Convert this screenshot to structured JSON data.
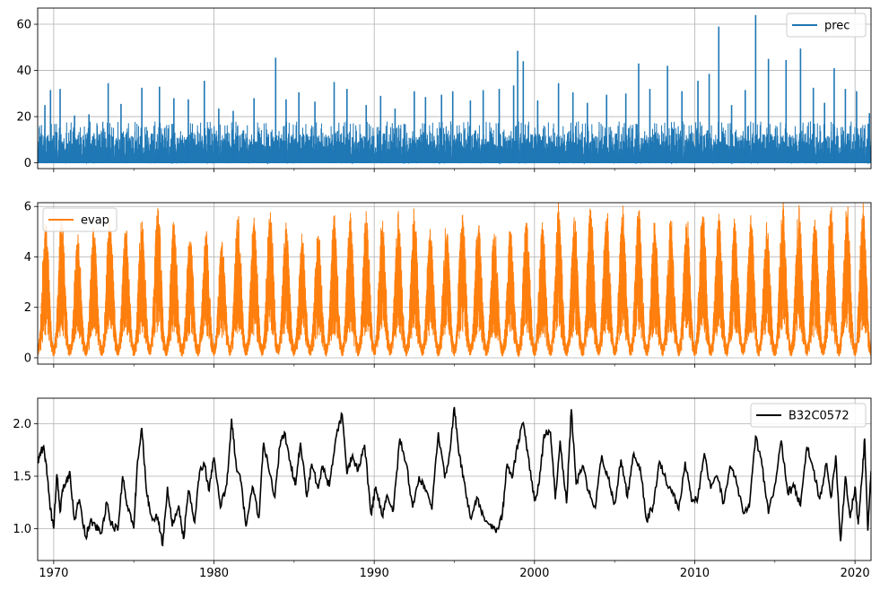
{
  "chart_data": [
    {
      "type": "line",
      "title": "",
      "xlabel": "",
      "ylabel": "",
      "xlim": [
        1969.0,
        2021.0
      ],
      "ylim": [
        -2.5,
        67.0
      ],
      "yticks": [
        0,
        20,
        40,
        60
      ],
      "ytick_labels": [
        "0",
        "20",
        "40",
        "60"
      ],
      "grid": true,
      "legend": "top-right",
      "series": [
        {
          "name": "prec",
          "color": "#1f77b4",
          "pattern": "daily precipitation spikes",
          "peaks": [
            [
              1969.45,
              25.0
            ],
            [
              1969.8,
              31.5
            ],
            [
              1970.4,
              32.0
            ],
            [
              1971.3,
              20.5
            ],
            [
              1972.2,
              21.0
            ],
            [
              1973.4,
              34.5
            ],
            [
              1974.2,
              25.5
            ],
            [
              1975.5,
              32.5
            ],
            [
              1976.6,
              33.0
            ],
            [
              1977.5,
              28.0
            ],
            [
              1978.4,
              27.5
            ],
            [
              1979.4,
              35.5
            ],
            [
              1980.3,
              23.5
            ],
            [
              1981.2,
              22.5
            ],
            [
              1982.5,
              28.0
            ],
            [
              1983.85,
              45.5
            ],
            [
              1984.5,
              27.5
            ],
            [
              1985.3,
              30.5
            ],
            [
              1986.3,
              26.5
            ],
            [
              1987.5,
              35.0
            ],
            [
              1988.3,
              32.0
            ],
            [
              1989.5,
              25.0
            ],
            [
              1990.4,
              29.0
            ],
            [
              1991.3,
              23.5
            ],
            [
              1992.5,
              31.0
            ],
            [
              1993.2,
              28.5
            ],
            [
              1994.2,
              29.5
            ],
            [
              1994.9,
              31.0
            ],
            [
              1996.0,
              27.0
            ],
            [
              1996.8,
              31.5
            ],
            [
              1997.8,
              32.0
            ],
            [
              1998.7,
              33.5
            ],
            [
              1998.95,
              48.5
            ],
            [
              1999.3,
              44.0
            ],
            [
              2000.2,
              27.0
            ],
            [
              2001.5,
              34.5
            ],
            [
              2002.4,
              30.5
            ],
            [
              2003.3,
              26.0
            ],
            [
              2004.5,
              29.5
            ],
            [
              2005.7,
              30.0
            ],
            [
              2006.5,
              43.0
            ],
            [
              2007.2,
              32.0
            ],
            [
              2008.3,
              42.0
            ],
            [
              2009.2,
              31.0
            ],
            [
              2010.2,
              35.5
            ],
            [
              2010.9,
              38.5
            ],
            [
              2011.5,
              59.0
            ],
            [
              2012.3,
              25.0
            ],
            [
              2013.15,
              31.5
            ],
            [
              2013.8,
              64.0
            ],
            [
              2014.6,
              45.0
            ],
            [
              2015.7,
              44.5
            ],
            [
              2016.6,
              49.5
            ],
            [
              2017.4,
              32.5
            ],
            [
              2018.1,
              26.0
            ],
            [
              2018.7,
              41.0
            ],
            [
              2019.4,
              32.0
            ],
            [
              2020.1,
              31.0
            ],
            [
              2020.9,
              21.5
            ]
          ]
        }
      ]
    },
    {
      "type": "line",
      "title": "",
      "xlabel": "",
      "ylabel": "",
      "xlim": [
        1969.0,
        2021.0
      ],
      "ylim": [
        -0.25,
        6.15
      ],
      "yticks": [
        0,
        2,
        4,
        6
      ],
      "ytick_labels": [
        "0",
        "2",
        "4",
        "6"
      ],
      "grid": true,
      "legend": "top-left",
      "series": [
        {
          "name": "evap",
          "color": "#ff7f0e",
          "pattern": "seasonal daily evaporation",
          "annual_peaks": [
            [
              1969.5,
              5.1
            ],
            [
              1970.5,
              5.2
            ],
            [
              1971.5,
              4.6
            ],
            [
              1972.5,
              4.8
            ],
            [
              1973.5,
              5.4
            ],
            [
              1974.5,
              4.8
            ],
            [
              1975.5,
              5.2
            ],
            [
              1976.5,
              5.7
            ],
            [
              1977.5,
              5.2
            ],
            [
              1978.5,
              4.6
            ],
            [
              1979.5,
              4.7
            ],
            [
              1980.5,
              4.4
            ],
            [
              1981.5,
              5.3
            ],
            [
              1982.5,
              5.2
            ],
            [
              1983.5,
              5.6
            ],
            [
              1984.5,
              5.2
            ],
            [
              1985.5,
              4.4
            ],
            [
              1986.5,
              4.8
            ],
            [
              1987.5,
              5.2
            ],
            [
              1988.5,
              5.4
            ],
            [
              1989.5,
              5.3
            ],
            [
              1990.5,
              5.2
            ],
            [
              1991.5,
              5.3
            ],
            [
              1992.5,
              5.5
            ],
            [
              1993.5,
              5.0
            ],
            [
              1994.5,
              5.1
            ],
            [
              1995.5,
              5.5
            ],
            [
              1996.5,
              5.1
            ],
            [
              1997.5,
              4.8
            ],
            [
              1998.5,
              4.8
            ],
            [
              1999.5,
              5.3
            ],
            [
              2000.5,
              5.1
            ],
            [
              2001.5,
              5.8
            ],
            [
              2002.5,
              5.3
            ],
            [
              2003.5,
              5.8
            ],
            [
              2004.5,
              5.6
            ],
            [
              2005.5,
              5.6
            ],
            [
              2006.5,
              5.6
            ],
            [
              2007.5,
              5.1
            ],
            [
              2008.5,
              5.3
            ],
            [
              2009.5,
              5.2
            ],
            [
              2010.5,
              5.6
            ],
            [
              2011.5,
              5.4
            ],
            [
              2012.5,
              5.1
            ],
            [
              2013.5,
              5.3
            ],
            [
              2014.5,
              5.0
            ],
            [
              2015.5,
              5.9
            ],
            [
              2016.5,
              5.6
            ],
            [
              2017.5,
              5.3
            ],
            [
              2018.5,
              5.7
            ],
            [
              2019.5,
              5.7
            ],
            [
              2020.5,
              5.6
            ]
          ],
          "base_value": 0.05
        }
      ]
    },
    {
      "type": "line",
      "title": "",
      "xlabel": "",
      "ylabel": "",
      "xlim": [
        1969.0,
        2021.0
      ],
      "ylim": [
        0.695,
        2.245
      ],
      "yticks": [
        1.0,
        1.5,
        2.0
      ],
      "ytick_labels": [
        "1.0",
        "1.5",
        "2.0"
      ],
      "xticks": [
        1970,
        1980,
        1990,
        2000,
        2010,
        2020
      ],
      "xtick_labels": [
        "1970",
        "1980",
        "1990",
        "2000",
        "2010",
        "2020"
      ],
      "grid": true,
      "legend": "top-right",
      "series": [
        {
          "name": "B32C0572",
          "color": "#000000",
          "x": [
            1969.0,
            1969.2,
            1969.4,
            1969.6,
            1969.8,
            1970.0,
            1970.2,
            1970.4,
            1970.6,
            1970.8,
            1971.0,
            1971.3,
            1971.6,
            1972.0,
            1972.3,
            1972.6,
            1973.0,
            1973.3,
            1973.6,
            1974.0,
            1974.3,
            1974.6,
            1975.0,
            1975.2,
            1975.5,
            1975.8,
            1976.1,
            1976.5,
            1976.8,
            1977.1,
            1977.4,
            1977.8,
            1978.1,
            1978.4,
            1978.8,
            1979.1,
            1979.4,
            1979.7,
            1980.0,
            1980.4,
            1980.8,
            1981.1,
            1981.4,
            1981.7,
            1982.0,
            1982.4,
            1982.8,
            1983.1,
            1983.4,
            1983.8,
            1984.1,
            1984.4,
            1984.8,
            1985.1,
            1985.4,
            1985.8,
            1986.1,
            1986.5,
            1986.8,
            1987.2,
            1987.6,
            1988.0,
            1988.3,
            1988.6,
            1989.0,
            1989.4,
            1989.8,
            1990.1,
            1990.5,
            1990.8,
            1991.2,
            1991.6,
            1992.0,
            1992.4,
            1992.8,
            1993.2,
            1993.6,
            1994.0,
            1994.4,
            1994.7,
            1995.0,
            1995.3,
            1995.6,
            1996.0,
            1996.4,
            1996.8,
            1997.2,
            1997.6,
            1998.0,
            1998.3,
            1998.6,
            1999.0,
            1999.3,
            1999.6,
            2000.0,
            2000.3,
            2000.6,
            2001.0,
            2001.3,
            2001.6,
            2002.0,
            2002.3,
            2002.6,
            2003.0,
            2003.4,
            2003.8,
            2004.2,
            2004.6,
            2005.0,
            2005.4,
            2005.8,
            2006.2,
            2006.6,
            2007.0,
            2007.4,
            2007.8,
            2008.2,
            2008.6,
            2009.0,
            2009.4,
            2009.8,
            2010.2,
            2010.6,
            2011.0,
            2011.4,
            2011.8,
            2012.2,
            2012.6,
            2013.0,
            2013.4,
            2013.8,
            2014.2,
            2014.6,
            2015.0,
            2015.4,
            2015.8,
            2016.2,
            2016.6,
            2017.0,
            2017.4,
            2017.8,
            2018.2,
            2018.5,
            2018.8,
            2019.1,
            2019.4,
            2019.7,
            2020.0,
            2020.2,
            2020.4,
            2020.6,
            2020.8,
            2021.0
          ],
          "y": [
            1.62,
            1.74,
            1.76,
            1.5,
            1.18,
            1.0,
            1.52,
            1.16,
            1.4,
            1.45,
            1.55,
            1.08,
            1.28,
            0.92,
            1.08,
            1.02,
            0.96,
            1.25,
            1.04,
            0.98,
            1.5,
            1.22,
            1.0,
            1.58,
            1.96,
            1.34,
            1.12,
            1.1,
            0.84,
            1.4,
            1.02,
            1.22,
            0.9,
            1.36,
            1.06,
            1.54,
            1.62,
            1.36,
            1.68,
            1.2,
            1.42,
            2.05,
            1.58,
            1.44,
            1.02,
            1.4,
            1.1,
            1.82,
            1.58,
            1.3,
            1.78,
            1.92,
            1.6,
            1.42,
            1.82,
            1.3,
            1.62,
            1.38,
            1.6,
            1.4,
            1.86,
            2.09,
            1.52,
            1.68,
            1.56,
            1.8,
            1.14,
            1.4,
            1.12,
            1.32,
            1.18,
            1.86,
            1.62,
            1.2,
            1.5,
            1.36,
            1.18,
            1.92,
            1.48,
            1.72,
            2.16,
            1.7,
            1.46,
            1.1,
            1.3,
            1.12,
            1.04,
            0.96,
            1.14,
            1.62,
            1.48,
            1.84,
            2.01,
            1.7,
            1.26,
            1.44,
            1.9,
            1.92,
            1.28,
            1.84,
            1.24,
            2.14,
            1.42,
            1.6,
            1.34,
            1.2,
            1.7,
            1.48,
            1.24,
            1.66,
            1.3,
            1.72,
            1.58,
            1.08,
            1.22,
            1.64,
            1.46,
            1.36,
            1.18,
            1.64,
            1.26,
            1.3,
            1.72,
            1.38,
            1.5,
            1.24,
            1.6,
            1.44,
            1.16,
            1.2,
            1.88,
            1.6,
            1.14,
            1.42,
            1.84,
            1.34,
            1.4,
            1.22,
            1.78,
            1.56,
            1.28,
            1.62,
            1.3,
            1.7,
            0.88,
            1.5,
            1.1,
            1.4,
            1.04,
            1.42,
            1.86,
            0.98,
            1.55
          ]
        }
      ]
    }
  ]
}
